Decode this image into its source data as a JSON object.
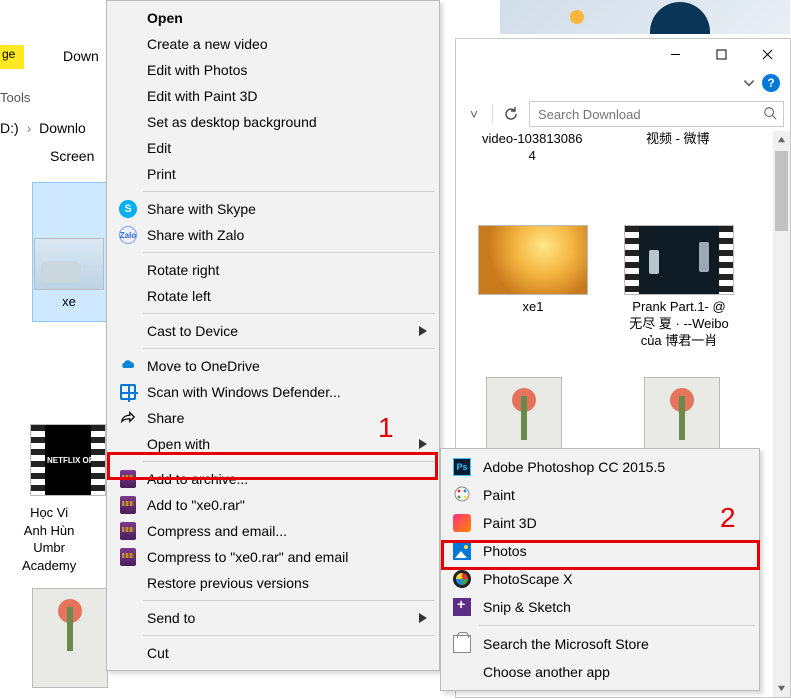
{
  "background": {
    "ribbon_partial": "ge",
    "down_tab": "Down",
    "tools": "Tools",
    "drive": "D:)",
    "folder": "Downlo",
    "screen_caption_partial": "Screen",
    "selected_caption_partial": "xe",
    "netflix_label": "A NETFLIX ORI",
    "left_captions": [
      "Học Vi",
      "Anh Hùn",
      "Umbr",
      "Academy"
    ]
  },
  "window": {
    "help_glyph": "?",
    "addr_chevron": "˅",
    "refresh_tooltip": "Refresh",
    "search_placeholder": "Search Download",
    "files": {
      "video_caption_top": "video-103813086",
      "video_caption_bottom": "4",
      "weibo_caption": "视频 - 微博",
      "xe1_caption": "xe1",
      "prank_line1": "Prank Part.1- @",
      "prank_line2": "无尽 夏 · --Weibo",
      "prank_line3": "của 博君一肖"
    }
  },
  "context_menu": {
    "items": [
      {
        "label": "Open",
        "bold": true
      },
      {
        "label": "Create a new video"
      },
      {
        "label": "Edit with Photos"
      },
      {
        "label": "Edit with Paint 3D"
      },
      {
        "label": "Set as desktop background"
      },
      {
        "label": "Edit"
      },
      {
        "label": "Print"
      },
      {
        "sep": true
      },
      {
        "label": "Share with Skype",
        "icon": "skype"
      },
      {
        "label": "Share with Zalo",
        "icon": "zalo"
      },
      {
        "sep": true
      },
      {
        "label": "Rotate right"
      },
      {
        "label": "Rotate left"
      },
      {
        "sep": true
      },
      {
        "label": "Cast to Device",
        "submenu": true
      },
      {
        "sep": true
      },
      {
        "label": "Move to OneDrive",
        "icon": "onedrive"
      },
      {
        "label": "Scan with Windows Defender...",
        "icon": "defender"
      },
      {
        "label": "Share",
        "icon": "share"
      },
      {
        "label": "Open with",
        "submenu": true,
        "highlight": 1
      },
      {
        "sep": true
      },
      {
        "label": "Add to archive...",
        "icon": "rar"
      },
      {
        "label": "Add to \"xe0.rar\"",
        "icon": "rar"
      },
      {
        "label": "Compress and email...",
        "icon": "rar"
      },
      {
        "label": "Compress to \"xe0.rar\" and email",
        "icon": "rar"
      },
      {
        "label": "Restore previous versions"
      },
      {
        "sep": true
      },
      {
        "label": "Send to",
        "submenu": true
      },
      {
        "sep": true
      },
      {
        "label": "Cut"
      }
    ]
  },
  "openwith_menu": {
    "items": [
      {
        "label": "Adobe Photoshop CC 2015.5",
        "icon": "ps"
      },
      {
        "label": "Paint",
        "icon": "paint"
      },
      {
        "label": "Paint 3D",
        "icon": "p3d"
      },
      {
        "label": "Photos",
        "icon": "photos",
        "highlight": 2
      },
      {
        "label": "PhotoScape X",
        "icon": "pscx"
      },
      {
        "label": "Snip & Sketch",
        "icon": "snip"
      },
      {
        "sep": true
      },
      {
        "label": "Search the Microsoft Store",
        "icon": "store"
      },
      {
        "label": "Choose another app"
      }
    ]
  },
  "annotations": {
    "one": "1",
    "two": "2"
  }
}
